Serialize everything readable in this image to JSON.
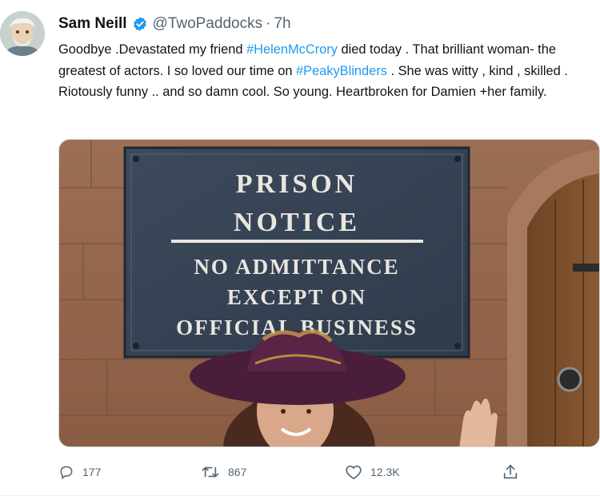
{
  "tweet": {
    "author_name": "Sam Neill",
    "handle": "@TwoPaddocks",
    "separator": "·",
    "time": "7h",
    "text_parts": {
      "p1": "Goodbye .Devastated my friend ",
      "tag1": "#HelenMcCrory",
      "p2": " died today . That brilliant woman- the greatest of actors. I so loved our time on ",
      "tag2": "#PeakyBlinders",
      "p3": " . She was witty , kind , skilled . Riotously funny .. and so damn cool. So young. Heartbroken for Damien +her family."
    },
    "image": {
      "sign_line1": "PRISON",
      "sign_line2": "NOTICE",
      "sign_line3": "NO ADMITTANCE",
      "sign_line4": "EXCEPT ON",
      "sign_line5": "OFFICIAL BUSINESS"
    },
    "actions": {
      "replies": "177",
      "retweets": "867",
      "likes": "12.3K"
    }
  },
  "colors": {
    "accent": "#1d9bf0",
    "text_primary": "#0f1419",
    "text_secondary": "#536471"
  },
  "icons": [
    "avatar",
    "verified-badge-icon",
    "reply-icon",
    "retweet-icon",
    "like-icon",
    "share-icon"
  ]
}
